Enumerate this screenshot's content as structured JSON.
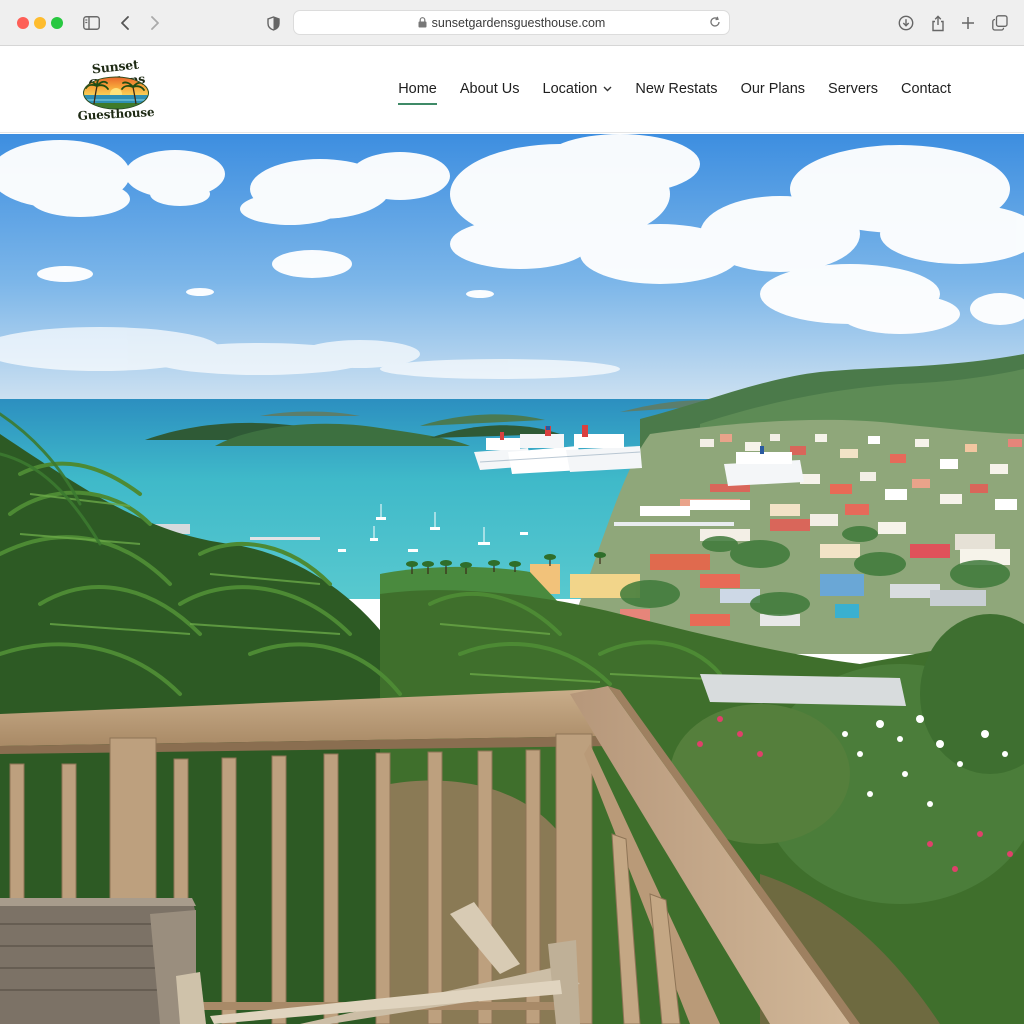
{
  "browser": {
    "url": "sunsetgardensguesthouse.com"
  },
  "logo": {
    "line1": "Sunset Gardens",
    "line2": "Guesthouse"
  },
  "nav": {
    "items": [
      {
        "label": "Home",
        "active": true
      },
      {
        "label": "About Us",
        "active": false
      },
      {
        "label": "Location",
        "active": false,
        "has_dropdown": true
      },
      {
        "label": "New Restats",
        "active": false
      },
      {
        "label": "Our Plans",
        "active": false
      },
      {
        "label": "Servers",
        "active": false
      },
      {
        "label": "Contact",
        "active": false
      }
    ]
  },
  "colors": {
    "nav_active_underline": "#3f8a67",
    "sky_top": "#3d8ee0",
    "sea": "#3fb9c9"
  },
  "icons": [
    "sidebar-icon",
    "back-icon",
    "forward-icon",
    "shield-icon",
    "lock-icon",
    "reload-icon",
    "download-icon",
    "share-icon",
    "plus-icon",
    "tabs-icon",
    "chevron-down-icon"
  ]
}
